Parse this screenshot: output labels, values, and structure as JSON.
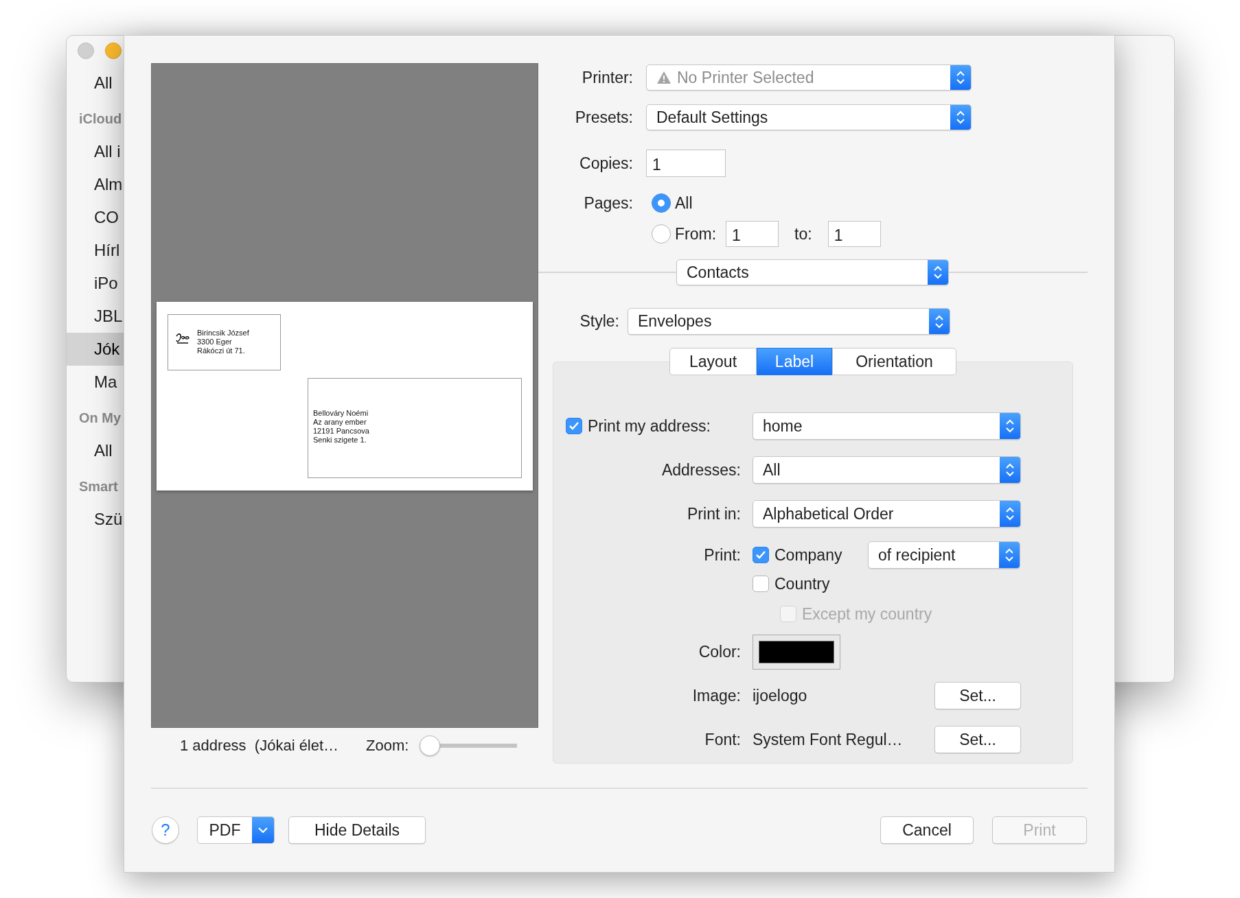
{
  "sidebar": {
    "items": [
      {
        "kind": "item",
        "label": "All",
        "selected": false
      },
      {
        "kind": "heading",
        "label": "iCloud"
      },
      {
        "kind": "item",
        "label": "All i",
        "selected": false
      },
      {
        "kind": "item",
        "label": "Alm",
        "selected": false
      },
      {
        "kind": "item",
        "label": "CO",
        "selected": false
      },
      {
        "kind": "item",
        "label": "Hírl",
        "selected": false
      },
      {
        "kind": "item",
        "label": "iPo",
        "selected": false
      },
      {
        "kind": "item",
        "label": "JBL",
        "selected": false
      },
      {
        "kind": "item",
        "label": "Jók",
        "selected": true
      },
      {
        "kind": "item",
        "label": "Ma",
        "selected": false
      },
      {
        "kind": "heading",
        "label": "On My"
      },
      {
        "kind": "item",
        "label": "All",
        "selected": false
      },
      {
        "kind": "heading",
        "label": "Smart"
      },
      {
        "kind": "item",
        "label": "Szü",
        "selected": false
      }
    ]
  },
  "preview": {
    "return_address": [
      "Birincsik József",
      "3300 Eger",
      "Rákóczi út 71."
    ],
    "recipient_address": [
      "Bellováry Noémi",
      "Az arany ember",
      "12191 Pancsova",
      "Senki szigete 1."
    ],
    "caption": "1 address  (Jókai élet…",
    "zoom": {
      "label": "Zoom:",
      "level": 0
    }
  },
  "printer": {
    "label": "Printer:",
    "value": "No Printer Selected",
    "disabled": true
  },
  "presets": {
    "label": "Presets:",
    "value": "Default Settings"
  },
  "copies": {
    "label": "Copies:",
    "value": "1"
  },
  "pages": {
    "label": "Pages:",
    "all": {
      "label": "All",
      "selected": true
    },
    "range": {
      "label": "From:",
      "selected": false,
      "from": "1",
      "to_label": "to:",
      "to": "1"
    }
  },
  "section_popup": "Contacts",
  "style": {
    "label": "Style:",
    "value": "Envelopes"
  },
  "tabs": [
    {
      "label": "Layout",
      "selected": false
    },
    {
      "label": "Label",
      "selected": true
    },
    {
      "label": "Orientation",
      "selected": false
    }
  ],
  "label_options": {
    "print_my_address": {
      "label": "Print my address:",
      "checked": true,
      "value": "home"
    },
    "addresses": {
      "label": "Addresses:",
      "value": "All"
    },
    "print_in": {
      "label": "Print in:",
      "value": "Alphabetical Order"
    },
    "print": {
      "label": "Print:",
      "company": {
        "label": "Company",
        "checked": true
      },
      "company_of": "of recipient",
      "country": {
        "label": "Country",
        "checked": false
      },
      "except_my_country": {
        "label": "Except my country",
        "checked": false,
        "disabled": true
      }
    },
    "color": {
      "label": "Color:",
      "color": "#000000"
    },
    "image": {
      "label": "Image:",
      "value": "ijoelogo",
      "button": "Set..."
    },
    "font": {
      "label": "Font:",
      "value": "System Font Regul…",
      "button": "Set..."
    }
  },
  "footer": {
    "help": "?",
    "pdf": "PDF",
    "hide_details": "Hide Details",
    "cancel": "Cancel",
    "print": {
      "label": "Print",
      "disabled": true
    }
  }
}
